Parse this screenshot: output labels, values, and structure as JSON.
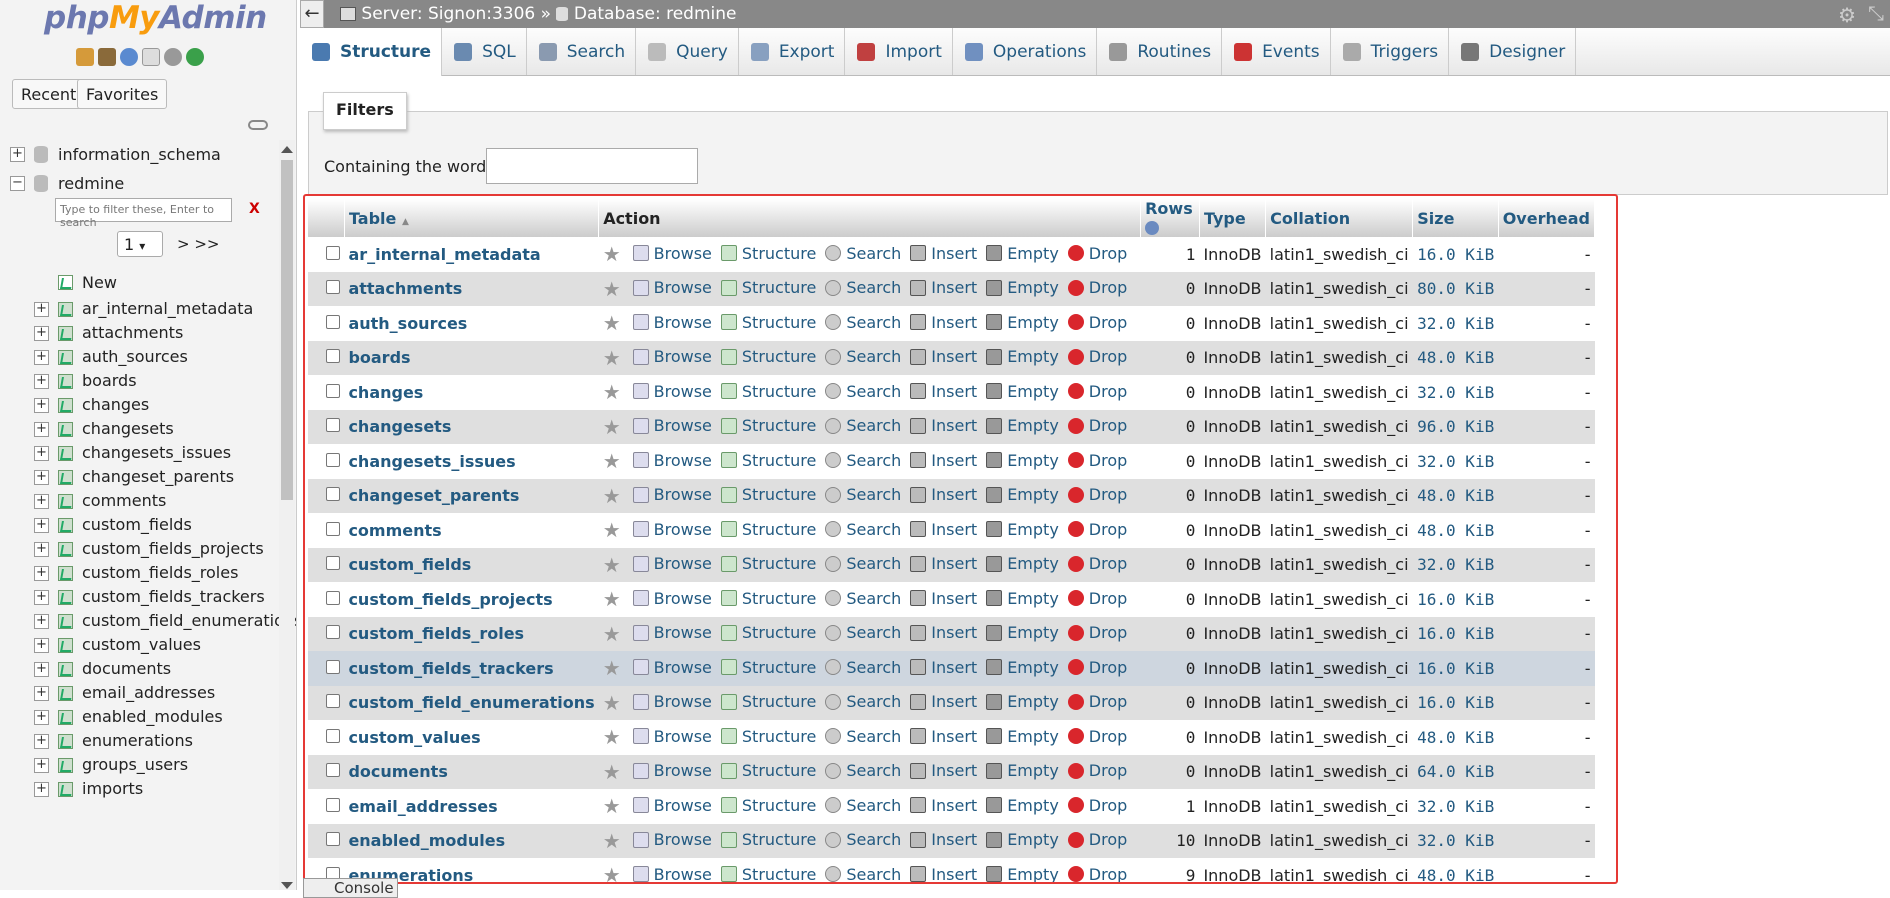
{
  "sidebar": {
    "logo_php": "php",
    "logo_my": "My",
    "logo_admin": "Admin",
    "recent_label": "Recent",
    "favorites_label": "Favorites",
    "databases": [
      "information_schema",
      "redmine"
    ],
    "filter_placeholder": "Type to filter these, Enter to search",
    "filter_clear": "X",
    "page_value": "1",
    "page_nav": "> >>",
    "new_label": "New",
    "tables": [
      "ar_internal_metadata",
      "attachments",
      "auth_sources",
      "boards",
      "changes",
      "changesets",
      "changesets_issues",
      "changeset_parents",
      "comments",
      "custom_fields",
      "custom_fields_projects",
      "custom_fields_roles",
      "custom_fields_trackers",
      "custom_field_enumerations",
      "custom_values",
      "documents",
      "email_addresses",
      "enabled_modules",
      "enumerations",
      "groups_users",
      "imports"
    ]
  },
  "topbar": {
    "collapse": "←",
    "server": "Server: Signon:3306",
    "sep": "»",
    "database": "Database: redmine"
  },
  "tabs": [
    {
      "label": "Structure",
      "color": "#4a7ab0"
    },
    {
      "label": "SQL",
      "color": "#6a8ab0"
    },
    {
      "label": "Search",
      "color": "#8a9ab0"
    },
    {
      "label": "Query",
      "color": "#bbbbbb"
    },
    {
      "label": "Export",
      "color": "#88a0c0"
    },
    {
      "label": "Import",
      "color": "#c04040"
    },
    {
      "label": "Operations",
      "color": "#7090c0"
    },
    {
      "label": "Routines",
      "color": "#999999"
    },
    {
      "label": "Events",
      "color": "#cc3333"
    },
    {
      "label": "Triggers",
      "color": "#aaaaaa"
    },
    {
      "label": "Designer",
      "color": "#777777"
    }
  ],
  "filters": {
    "legend": "Filters",
    "containing_label": "Containing the word:",
    "containing_value": ""
  },
  "grid": {
    "headers": {
      "table": "Table",
      "sort_arrow": "▲",
      "action": "Action",
      "rows": "Rows",
      "type": "Type",
      "collation": "Collation",
      "size": "Size",
      "overhead": "Overhead"
    },
    "action_labels": {
      "browse": "Browse",
      "structure": "Structure",
      "search": "Search",
      "insert": "Insert",
      "empty": "Empty",
      "drop": "Drop"
    },
    "rows": [
      {
        "name": "ar_internal_metadata",
        "rows": "1",
        "type": "InnoDB",
        "collation": "latin1_swedish_ci",
        "size": "16.0 KiB",
        "overhead": "-"
      },
      {
        "name": "attachments",
        "rows": "0",
        "type": "InnoDB",
        "collation": "latin1_swedish_ci",
        "size": "80.0 KiB",
        "overhead": "-"
      },
      {
        "name": "auth_sources",
        "rows": "0",
        "type": "InnoDB",
        "collation": "latin1_swedish_ci",
        "size": "32.0 KiB",
        "overhead": "-"
      },
      {
        "name": "boards",
        "rows": "0",
        "type": "InnoDB",
        "collation": "latin1_swedish_ci",
        "size": "48.0 KiB",
        "overhead": "-"
      },
      {
        "name": "changes",
        "rows": "0",
        "type": "InnoDB",
        "collation": "latin1_swedish_ci",
        "size": "32.0 KiB",
        "overhead": "-"
      },
      {
        "name": "changesets",
        "rows": "0",
        "type": "InnoDB",
        "collation": "latin1_swedish_ci",
        "size": "96.0 KiB",
        "overhead": "-"
      },
      {
        "name": "changesets_issues",
        "rows": "0",
        "type": "InnoDB",
        "collation": "latin1_swedish_ci",
        "size": "32.0 KiB",
        "overhead": "-"
      },
      {
        "name": "changeset_parents",
        "rows": "0",
        "type": "InnoDB",
        "collation": "latin1_swedish_ci",
        "size": "48.0 KiB",
        "overhead": "-"
      },
      {
        "name": "comments",
        "rows": "0",
        "type": "InnoDB",
        "collation": "latin1_swedish_ci",
        "size": "48.0 KiB",
        "overhead": "-"
      },
      {
        "name": "custom_fields",
        "rows": "0",
        "type": "InnoDB",
        "collation": "latin1_swedish_ci",
        "size": "32.0 KiB",
        "overhead": "-"
      },
      {
        "name": "custom_fields_projects",
        "rows": "0",
        "type": "InnoDB",
        "collation": "latin1_swedish_ci",
        "size": "16.0 KiB",
        "overhead": "-"
      },
      {
        "name": "custom_fields_roles",
        "rows": "0",
        "type": "InnoDB",
        "collation": "latin1_swedish_ci",
        "size": "16.0 KiB",
        "overhead": "-"
      },
      {
        "name": "custom_fields_trackers",
        "rows": "0",
        "type": "InnoDB",
        "collation": "latin1_swedish_ci",
        "size": "16.0 KiB",
        "overhead": "-"
      },
      {
        "name": "custom_field_enumerations",
        "rows": "0",
        "type": "InnoDB",
        "collation": "latin1_swedish_ci",
        "size": "16.0 KiB",
        "overhead": "-"
      },
      {
        "name": "custom_values",
        "rows": "0",
        "type": "InnoDB",
        "collation": "latin1_swedish_ci",
        "size": "48.0 KiB",
        "overhead": "-"
      },
      {
        "name": "documents",
        "rows": "0",
        "type": "InnoDB",
        "collation": "latin1_swedish_ci",
        "size": "64.0 KiB",
        "overhead": "-"
      },
      {
        "name": "email_addresses",
        "rows": "1",
        "type": "InnoDB",
        "collation": "latin1_swedish_ci",
        "size": "32.0 KiB",
        "overhead": "-"
      },
      {
        "name": "enabled_modules",
        "rows": "10",
        "type": "InnoDB",
        "collation": "latin1_swedish_ci",
        "size": "32.0 KiB",
        "overhead": "-"
      },
      {
        "name": "enumerations",
        "rows": "9",
        "type": "InnoDB",
        "collation": "latin1_swedish_ci",
        "size": "48.0 KiB",
        "overhead": "-"
      }
    ]
  },
  "console_label": "Console",
  "colors": {
    "link": "#235a81",
    "highlight_border": "#e53935",
    "drop": "#d9262c"
  }
}
